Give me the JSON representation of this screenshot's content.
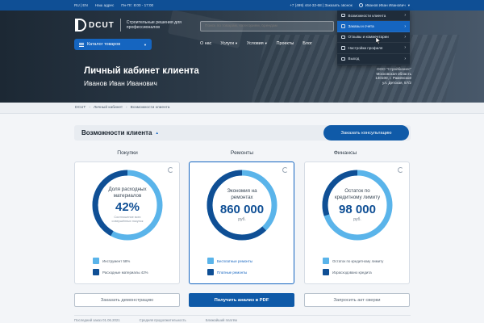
{
  "topbar": {
    "lang": "RU | EN",
    "address": "Наш адрес",
    "hours": "Пн-Пт: 8:00 - 17:00",
    "phone": "+7 (499) 444-32-68 | Заказать звонок",
    "user": "Иванов Иван Иванович"
  },
  "header": {
    "logo_text": "DCUT",
    "tagline": "Строительные решения для профессионалов",
    "search_placeholder": "Поиск по товарам, категориям, брендам",
    "catalog_button": "Каталог товаров",
    "nav": [
      "О нас",
      "Услуги",
      "Условия",
      "Проекты",
      "Блог"
    ],
    "title": "Личный кабинет клиента",
    "client_name": "Иванов Иван Иванович",
    "company_lines": [
      "ООО \"Стройбизнес\"",
      "Московская область",
      "140100, г. Раменское",
      "ул. Детская, 57/2"
    ]
  },
  "dropdown": {
    "items": [
      {
        "label": "Возможности клиента",
        "active": false
      },
      {
        "label": "Заказы и счета",
        "active": true
      },
      {
        "label": "Отзывы и комментарии",
        "active": false
      },
      {
        "label": "Настройки профиля",
        "active": false
      },
      {
        "label": "Выход",
        "active": false
      }
    ]
  },
  "breadcrumb": [
    "DCUT",
    "Личный кабинет",
    "Возможности клиента"
  ],
  "section": {
    "title": "Возможности клиента",
    "consult_button": "Заказать консультацию"
  },
  "cards": [
    {
      "column": "Покупки",
      "label": "Доля расходных материалов",
      "value": "42%",
      "unit": "",
      "note": "Соотношение всех совершённых покупок",
      "fraction": 0.42,
      "legend": [
        {
          "text": "Инструмент 58%",
          "color": "#5ab4ea"
        },
        {
          "text": "Расходные материалы 42%",
          "color": "#0f4f95"
        }
      ],
      "button": "Заказать демонстрацию"
    },
    {
      "column": "Ремонты",
      "label": "Экономия на ремонтах",
      "value": "860 000",
      "unit": "руб.",
      "note": "",
      "fraction": 0.62,
      "legend": [
        {
          "text": "Бесплатные ремонты",
          "color": "#5ab4ea"
        },
        {
          "text": "Платные ремонты",
          "color": "#0f4f95"
        }
      ],
      "button": "Получить анализ в PDF"
    },
    {
      "column": "Финансы",
      "label": "Остаток по кредитному лимиту",
      "value": "98 000",
      "unit": "руб.",
      "note": "",
      "fraction": 0.3,
      "legend": [
        {
          "text": "Остаток по кредитному лимиту",
          "color": "#5ab4ea"
        },
        {
          "text": "Израсходовано кредита",
          "color": "#0f4f95"
        }
      ],
      "button": "Запросить акт сверки"
    }
  ],
  "bottom": [
    "Последний заказ 01.06.2021",
    "Средняя продолжительность",
    "Ближайший платёж"
  ],
  "colors": {
    "primary": "#0f5aa8",
    "light_ring": "#5ab4ea",
    "dark_ring": "#0f4f95"
  }
}
